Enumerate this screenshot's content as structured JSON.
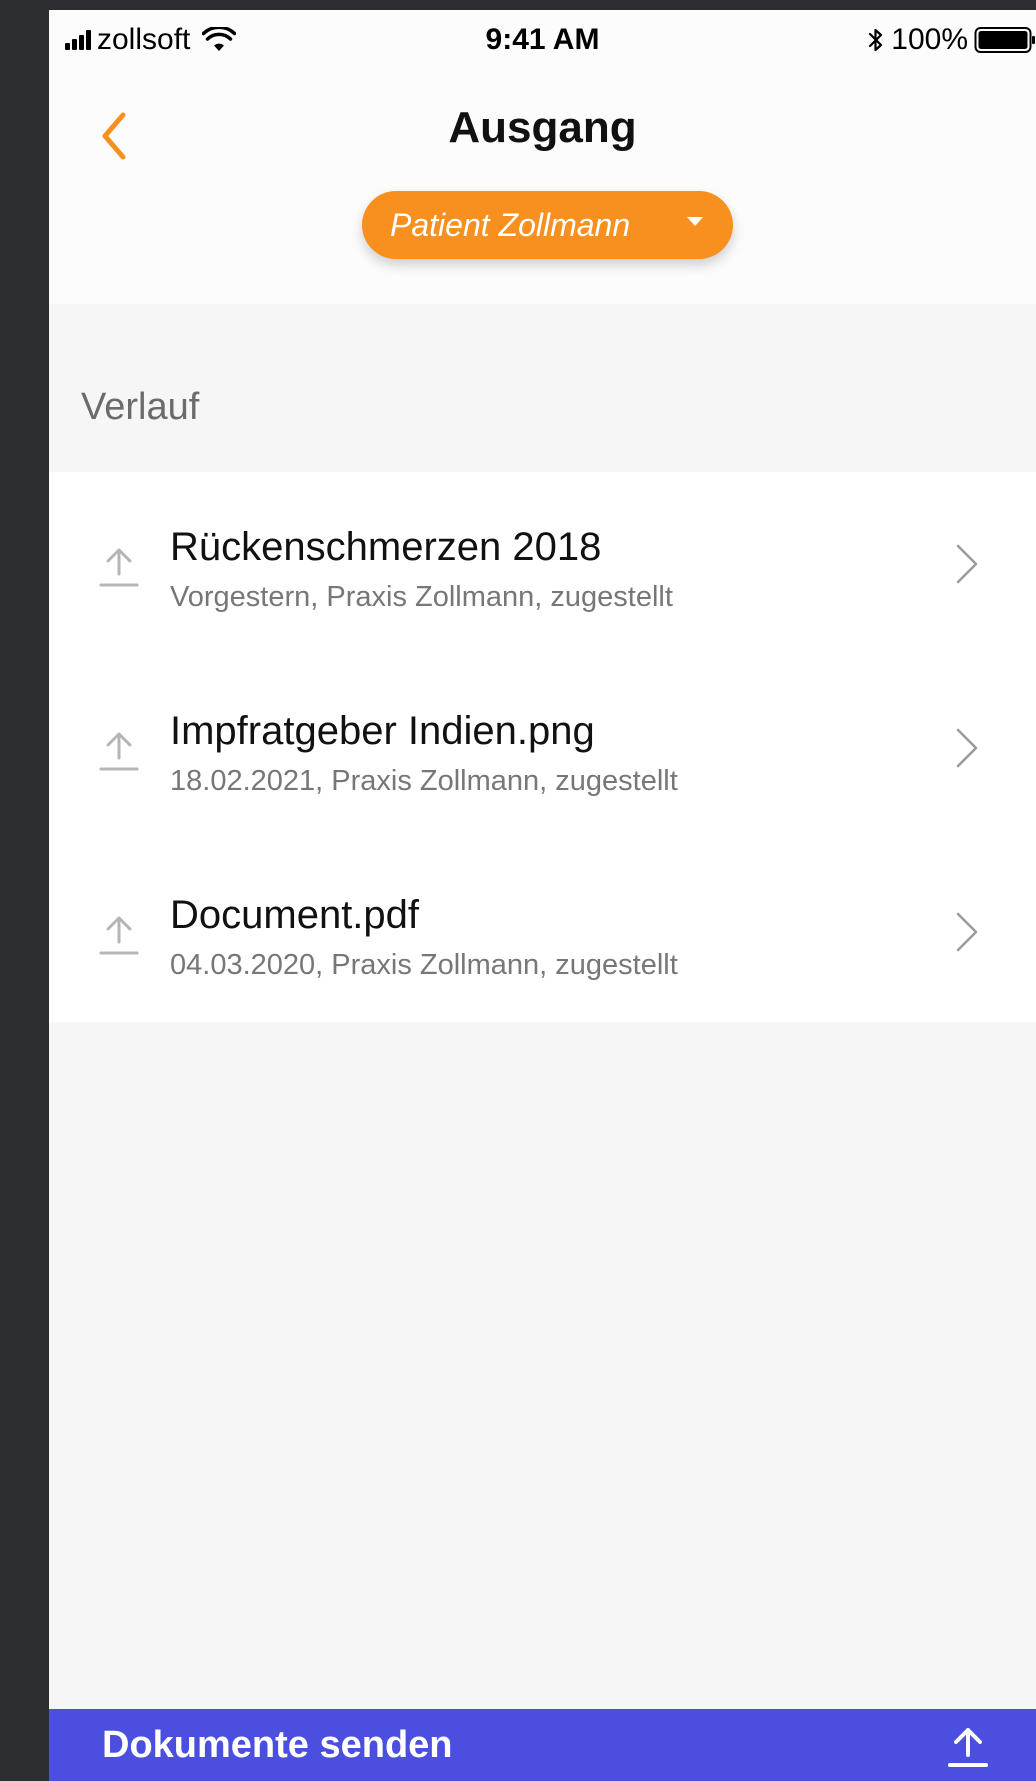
{
  "status_bar": {
    "carrier": "zollsoft",
    "time": "9:41 AM",
    "battery": "100%"
  },
  "header": {
    "title": "Ausgang",
    "patient_select": {
      "selected": "Patient Zollmann"
    }
  },
  "section": {
    "title": "Verlauf"
  },
  "documents": [
    {
      "title": "Rückenschmerzen 2018",
      "subtitle": "Vorgestern, Praxis Zollmann, zugestellt"
    },
    {
      "title": "Impfratgeber Indien.png",
      "subtitle": "18.02.2021, Praxis Zollmann, zugestellt"
    },
    {
      "title": "Document.pdf",
      "subtitle": "04.03.2020, Praxis Zollmann, zugestellt"
    }
  ],
  "bottom_bar": {
    "label": "Dokumente senden"
  },
  "colors": {
    "accent": "#f7901e",
    "primary": "#4a4fe0",
    "background": "#f6f6f6"
  }
}
